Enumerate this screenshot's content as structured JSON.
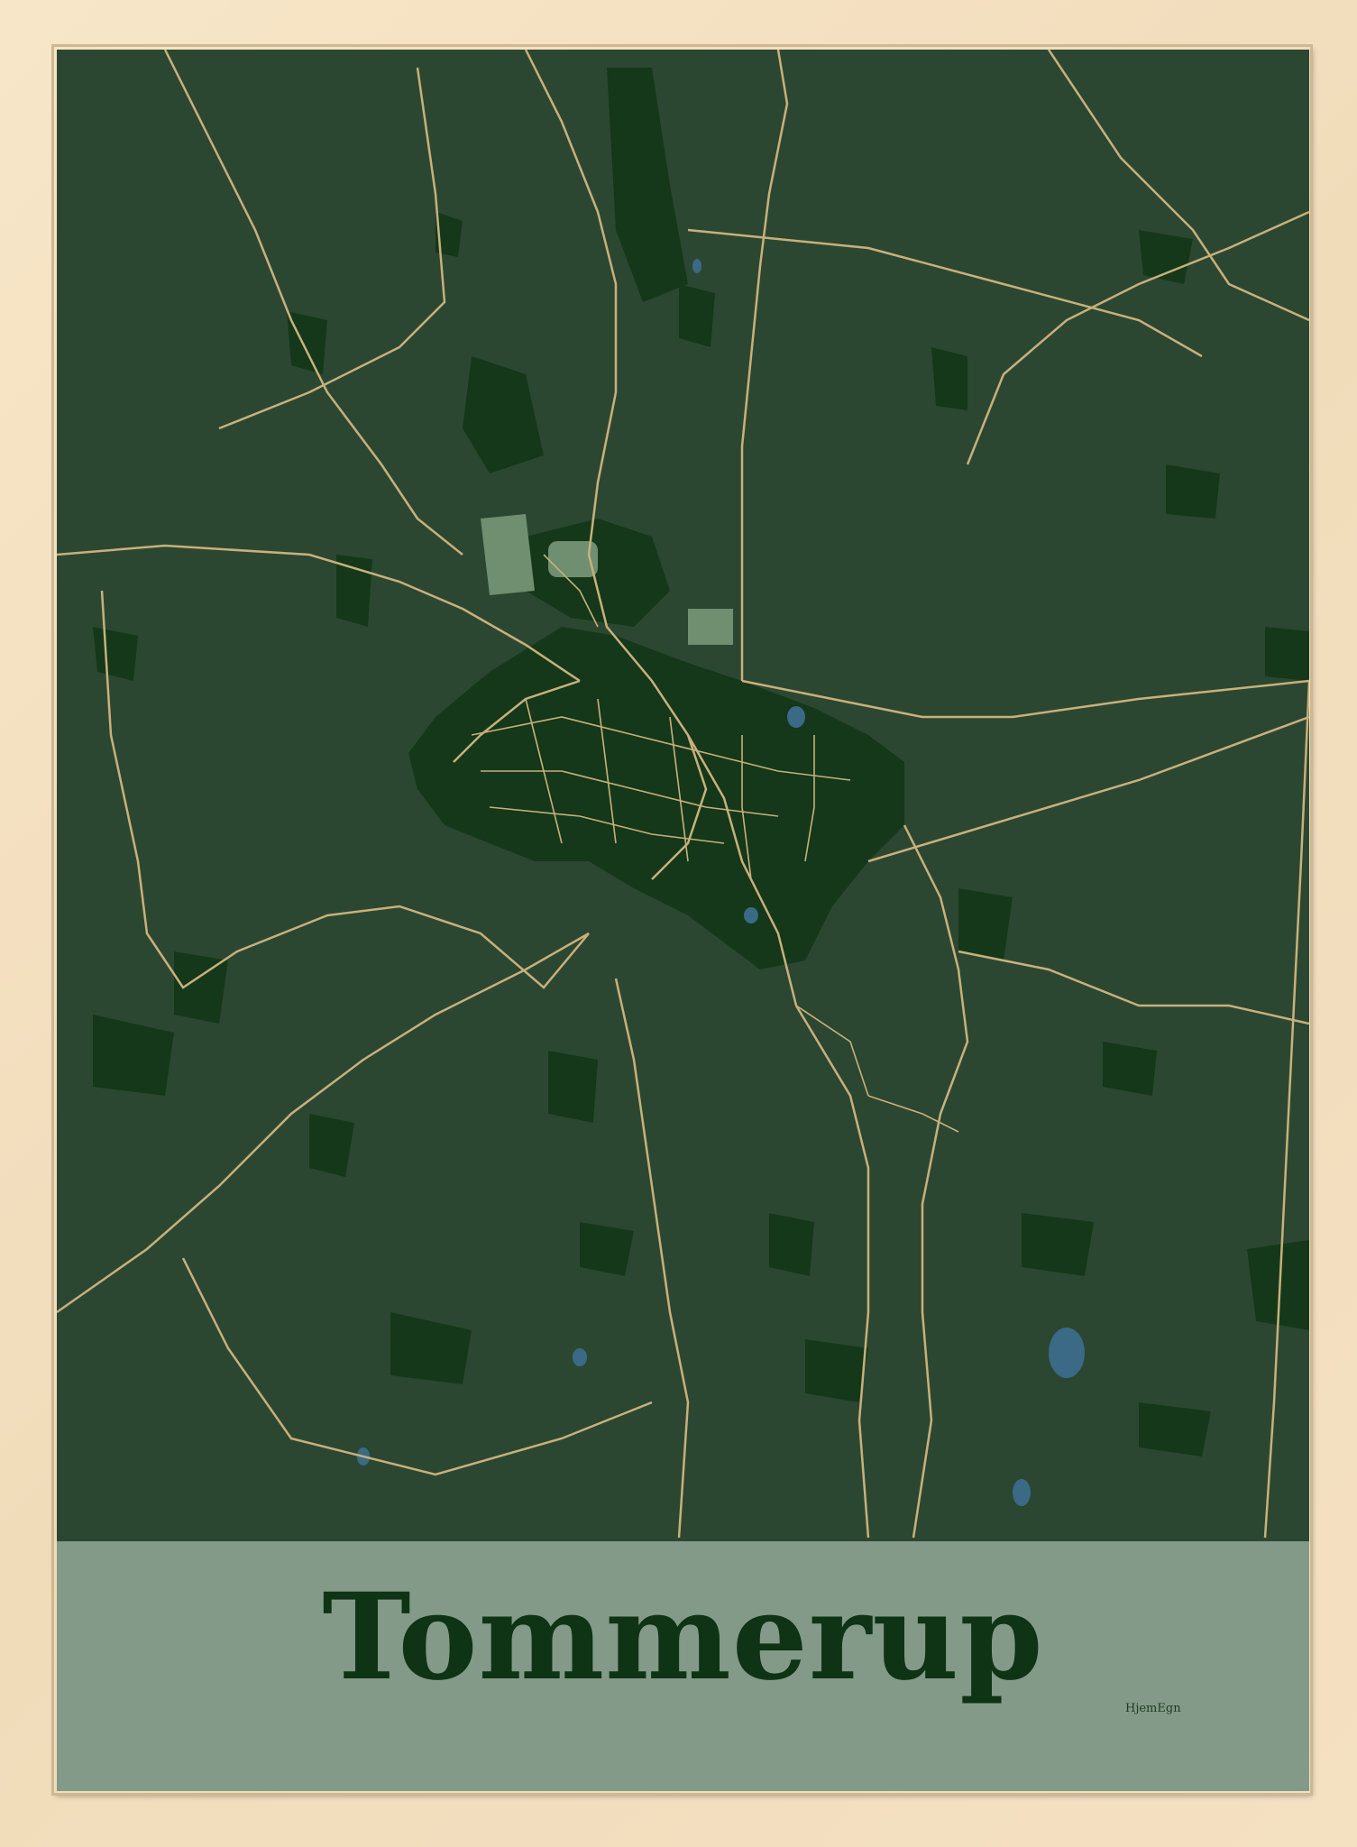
{
  "poster": {
    "place_name": "Tommerup",
    "brand": "HjemEgn"
  },
  "colors": {
    "frame": "#f3dfbf",
    "map_background": "#2c4731",
    "forest": "#143819",
    "roads": "#c8b07c",
    "water": "#3b6a86",
    "title": "#0e3315",
    "band": "#bacdbe"
  }
}
